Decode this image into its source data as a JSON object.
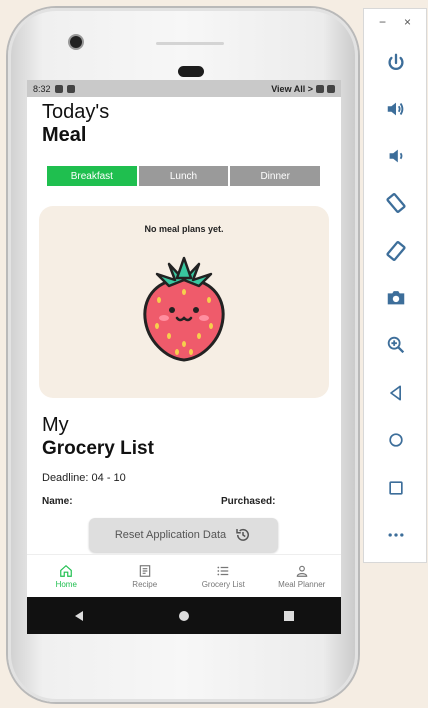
{
  "statusbar": {
    "time": "8:32",
    "overlay_text": "View All >"
  },
  "page": {
    "title_line1": "Today's",
    "title_line2": "Meal"
  },
  "meal_tabs": [
    {
      "label": "Breakfast",
      "active": true
    },
    {
      "label": "Lunch",
      "active": false
    },
    {
      "label": "Dinner",
      "active": false
    }
  ],
  "meal_card": {
    "message": "No meal plans yet."
  },
  "grocery": {
    "title_line1": "My",
    "title_line2": "Grocery List",
    "deadline": "Deadline: 04 - 10",
    "col_name": "Name:",
    "col_purchased": "Purchased:"
  },
  "reset_button": {
    "label": "Reset Application Data"
  },
  "bottom_nav": [
    {
      "label": "Home",
      "icon": "home-icon",
      "active": true
    },
    {
      "label": "Recipe",
      "icon": "recipe-icon",
      "active": false
    },
    {
      "label": "Grocery List",
      "icon": "list-icon",
      "active": false
    },
    {
      "label": "Meal Planner",
      "icon": "person-icon",
      "active": false
    }
  ],
  "emulator_toolbar": {
    "minimize": "−",
    "close": "×",
    "buttons": [
      "power-icon",
      "volume-up-icon",
      "volume-down-icon",
      "rotate-left-icon",
      "rotate-right-icon",
      "camera-icon",
      "zoom-icon",
      "back-icon",
      "home-icon",
      "overview-icon",
      "more-icon"
    ]
  },
  "colors": {
    "accent": "#1fbf4f",
    "tab_inactive": "#9a9a9a",
    "card_bg": "#f6eee4",
    "background": "#f5ede3"
  }
}
